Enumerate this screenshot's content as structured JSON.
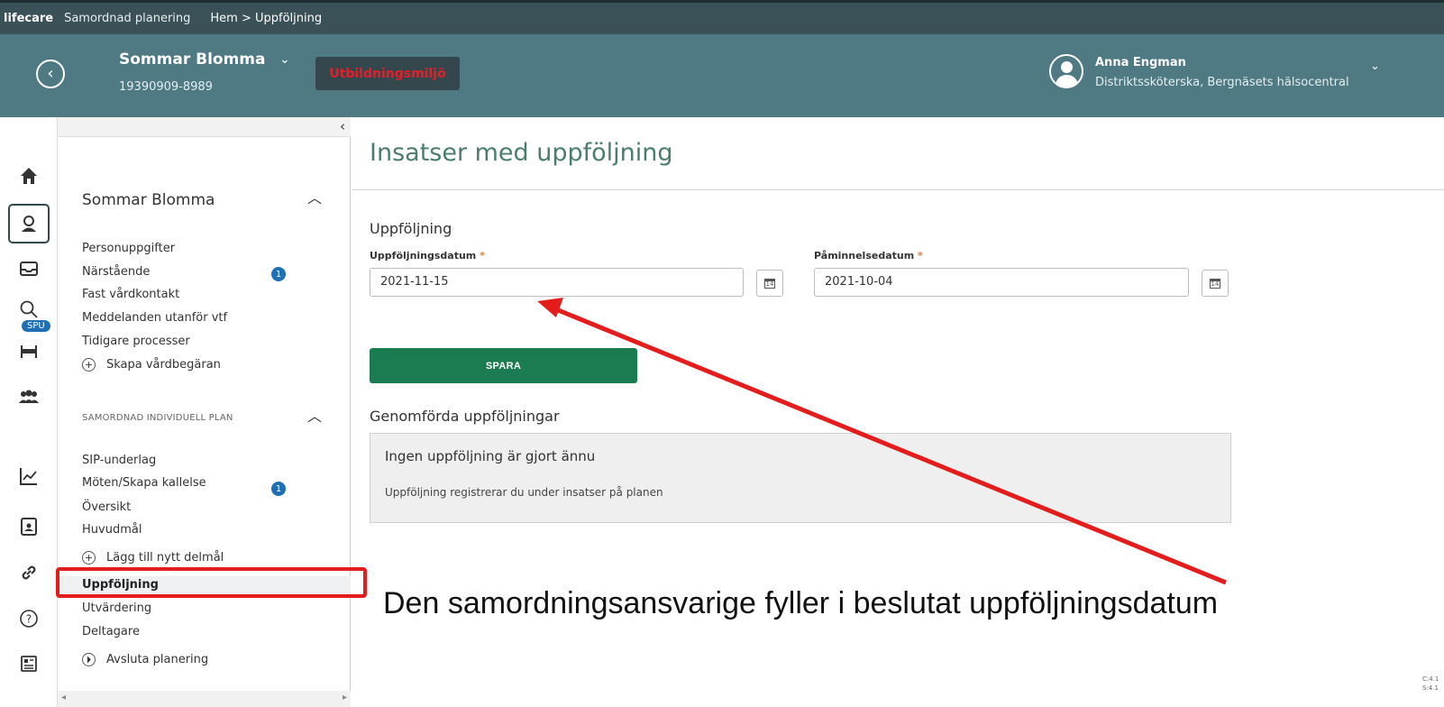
{
  "topbar": {
    "logo": "lifecare",
    "app_name": "Samordnad planering",
    "breadcrumb": "Hem > Uppföljning"
  },
  "patient": {
    "name": "Sommar Blomma",
    "id": "19390909-8989",
    "environment": "Utbildningsmiljö",
    "environment_color": "#e0202a"
  },
  "user": {
    "name": "Anna Engman",
    "role": "Distriktssköterska, Bergnäsets hälsocentral"
  },
  "rail": {
    "icons": [
      "home-icon",
      "patient-icon",
      "inbox-icon",
      "search-icon",
      "bed-icon",
      "group-icon",
      "chart-icon",
      "report-icon",
      "link-icon",
      "help-icon",
      "news-icon"
    ],
    "spu_badge": "SPU"
  },
  "side_panel": {
    "section1_title": "Sommar Blomma",
    "section1_items": [
      {
        "label": "Personuppgifter"
      },
      {
        "label": "Närstående",
        "badge": "1"
      },
      {
        "label": "Fast vårdkontakt"
      },
      {
        "label": "Meddelanden utanför vtf"
      },
      {
        "label": "Tidigare processer"
      },
      {
        "label": "Skapa vårdbegäran"
      }
    ],
    "section2_title": "SAMORDNAD INDIVIDUELL PLAN",
    "section2_items": [
      {
        "label": "SIP-underlag"
      },
      {
        "label": "Möten/Skapa kallelse",
        "badge": "1"
      },
      {
        "label": "Översikt"
      },
      {
        "label": "Huvudmål"
      },
      {
        "label": "Lägg till nytt delmål"
      },
      {
        "label": "Uppföljning"
      },
      {
        "label": "Utvärdering"
      },
      {
        "label": "Deltagare"
      },
      {
        "label": "Avsluta planering"
      }
    ]
  },
  "main": {
    "title": "Insatser med uppföljning",
    "section_heading": "Uppföljning",
    "followup_date_label": "Uppföljningsdatum",
    "followup_date_value": "2021-11-15",
    "reminder_date_label": "Påminnelsedatum",
    "reminder_date_value": "2021-10-04",
    "required_marker": "*",
    "save_label": "SPARA",
    "done_heading": "Genomförda uppföljningar",
    "empty_title": "Ingen uppföljning är gjort ännu",
    "empty_subtitle": "Uppföljning registrerar du under insatser på planen"
  },
  "annotation": {
    "text": "Den samordningsansvarige fyller i beslutat uppföljningsdatum",
    "color": "#e41c1c"
  },
  "version": {
    "line1": "C:4.1",
    "line2": "S:4.1"
  },
  "colors": {
    "topbar": "#3a5157",
    "header": "#4f7a83",
    "title_green": "#4a7d6f",
    "save_green": "#1b7c52",
    "badge_blue": "#1e6fb5"
  }
}
